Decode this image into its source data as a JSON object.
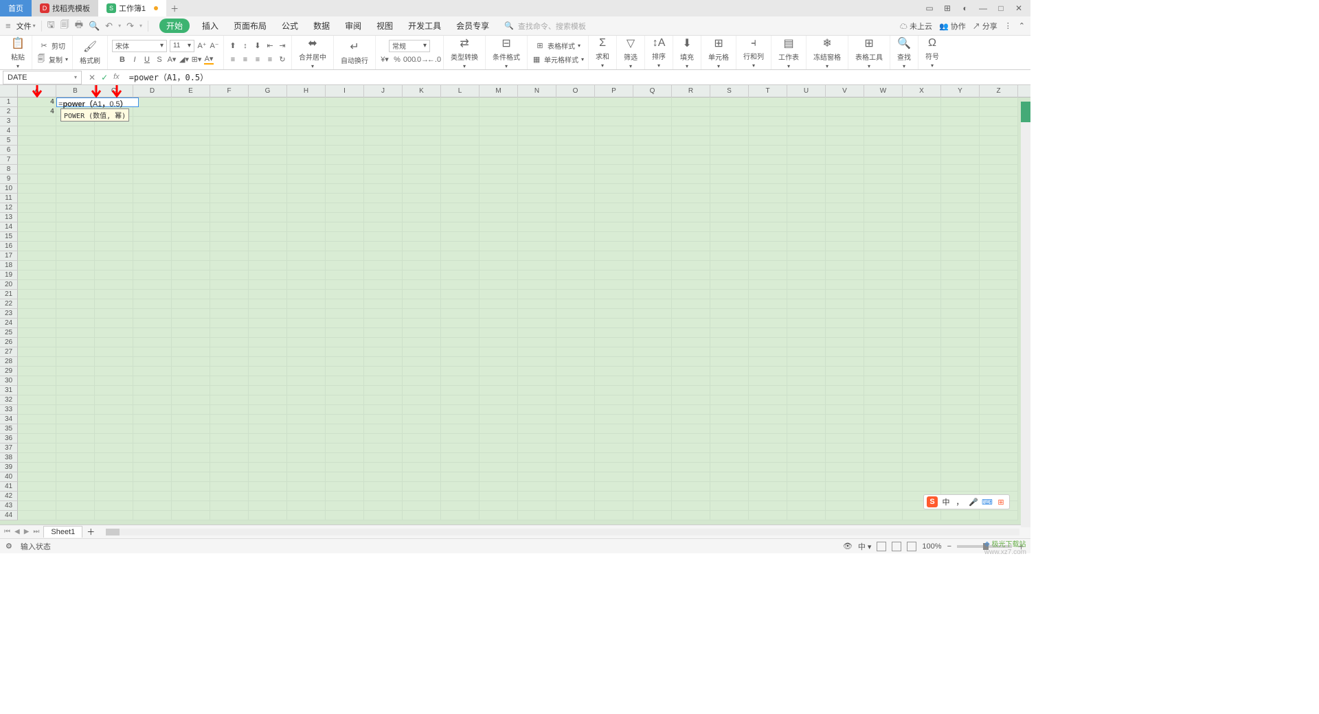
{
  "tabs": {
    "home": "首页",
    "template": "找稻壳模板",
    "workbook": "工作簿1"
  },
  "file_menu": "文件",
  "menu": [
    "开始",
    "插入",
    "页面布局",
    "公式",
    "数据",
    "审阅",
    "视图",
    "开发工具",
    "会员专享"
  ],
  "search_placeholder": "查找命令、搜索模板",
  "cloud": {
    "unsaved": "未上云",
    "coop": "协作",
    "share": "分享"
  },
  "ribbon": {
    "paste": "粘贴",
    "cut": "剪切",
    "copy": "复制",
    "format_painter": "格式刷",
    "font_name": "宋体",
    "font_size": "11",
    "merge": "合并居中",
    "wrap": "自动换行",
    "numfmt": "常规",
    "type_convert": "类型转换",
    "cond_fmt": "条件格式",
    "table_style": "表格样式",
    "cell_style": "单元格样式",
    "sum": "求和",
    "filter": "筛选",
    "sort": "排序",
    "fill": "填充",
    "cell": "单元格",
    "rowcol": "行和列",
    "sheet": "工作表",
    "freeze": "冻结窗格",
    "table_tools": "表格工具",
    "find": "查找",
    "symbol": "符号"
  },
  "namebox": "DATE",
  "formula": "=power（A1，0.5）",
  "cells": {
    "A1": "4",
    "A2": "4",
    "B1_editing": "=power（A1，0.5）"
  },
  "tooltip": "POWER (数值, 幂)",
  "columns": [
    "A",
    "B",
    "C",
    "D",
    "E",
    "F",
    "G",
    "H",
    "I",
    "J",
    "K",
    "L",
    "M",
    "N",
    "O",
    "P",
    "Q",
    "R",
    "S",
    "T",
    "U",
    "V",
    "W",
    "X",
    "Y",
    "Z"
  ],
  "row_count": 44,
  "sheet_name": "Sheet1",
  "status": {
    "mode": "输入状态",
    "zoom": "100%"
  },
  "ime": {
    "lang": "中",
    "punct": "，"
  },
  "watermark": {
    "brand": "极光下载站",
    "url": "www.xz7.com"
  }
}
